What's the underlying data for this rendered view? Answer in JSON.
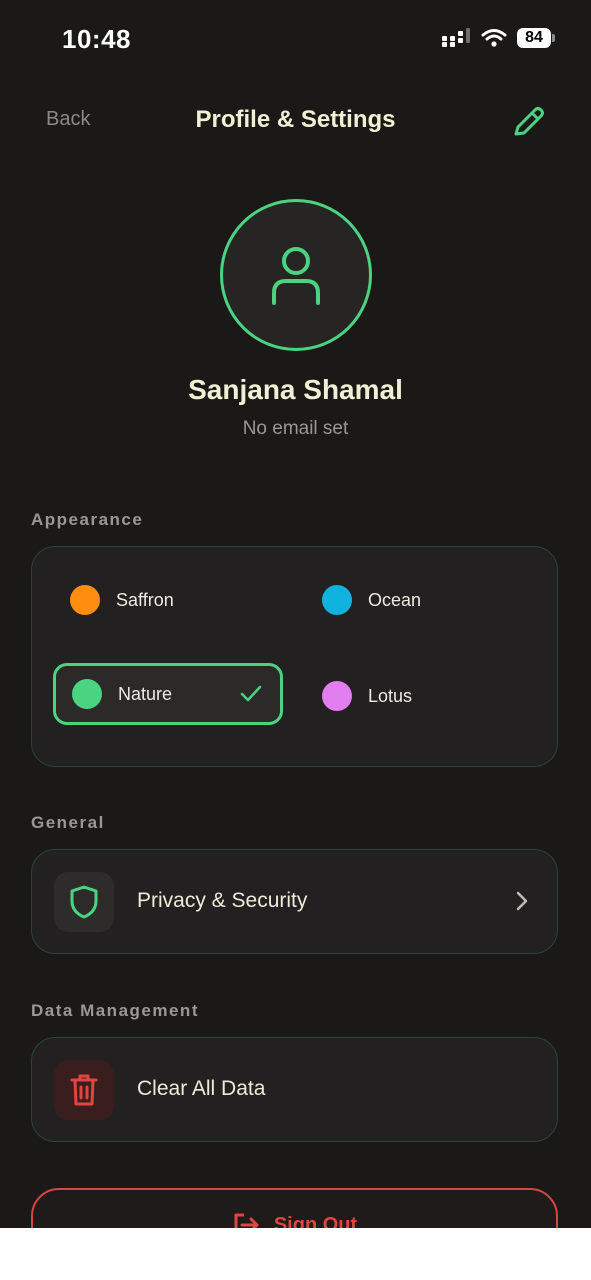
{
  "status_bar": {
    "time": "10:48",
    "battery": "84"
  },
  "header": {
    "back_label": "Back",
    "title": "Profile & Settings",
    "edit_icon": "pencil-icon"
  },
  "profile": {
    "avatar_icon": "user-icon",
    "name": "Sanjana Shamal",
    "email": "No email set"
  },
  "appearance": {
    "section_label": "Appearance",
    "themes": [
      {
        "label": "Saffron",
        "color": "#ff8e0f",
        "selected": false
      },
      {
        "label": "Ocean",
        "color": "#10b3e0",
        "selected": false
      },
      {
        "label": "Nature",
        "color": "#4ad381",
        "selected": true
      },
      {
        "label": "Lotus",
        "color": "#e37ef0",
        "selected": false
      }
    ]
  },
  "general": {
    "section_label": "General",
    "items": [
      {
        "label": "Privacy & Security",
        "icon": "shield-icon"
      }
    ]
  },
  "data_management": {
    "section_label": "Data Management",
    "items": [
      {
        "label": "Clear All Data",
        "icon": "trash-icon"
      }
    ]
  },
  "sign_out": {
    "label": "Sign Out",
    "icon": "sign-out-icon"
  },
  "colors": {
    "accent": "#4ad381",
    "danger": "#e0463f",
    "background": "#1b1918",
    "card": "#222020"
  }
}
